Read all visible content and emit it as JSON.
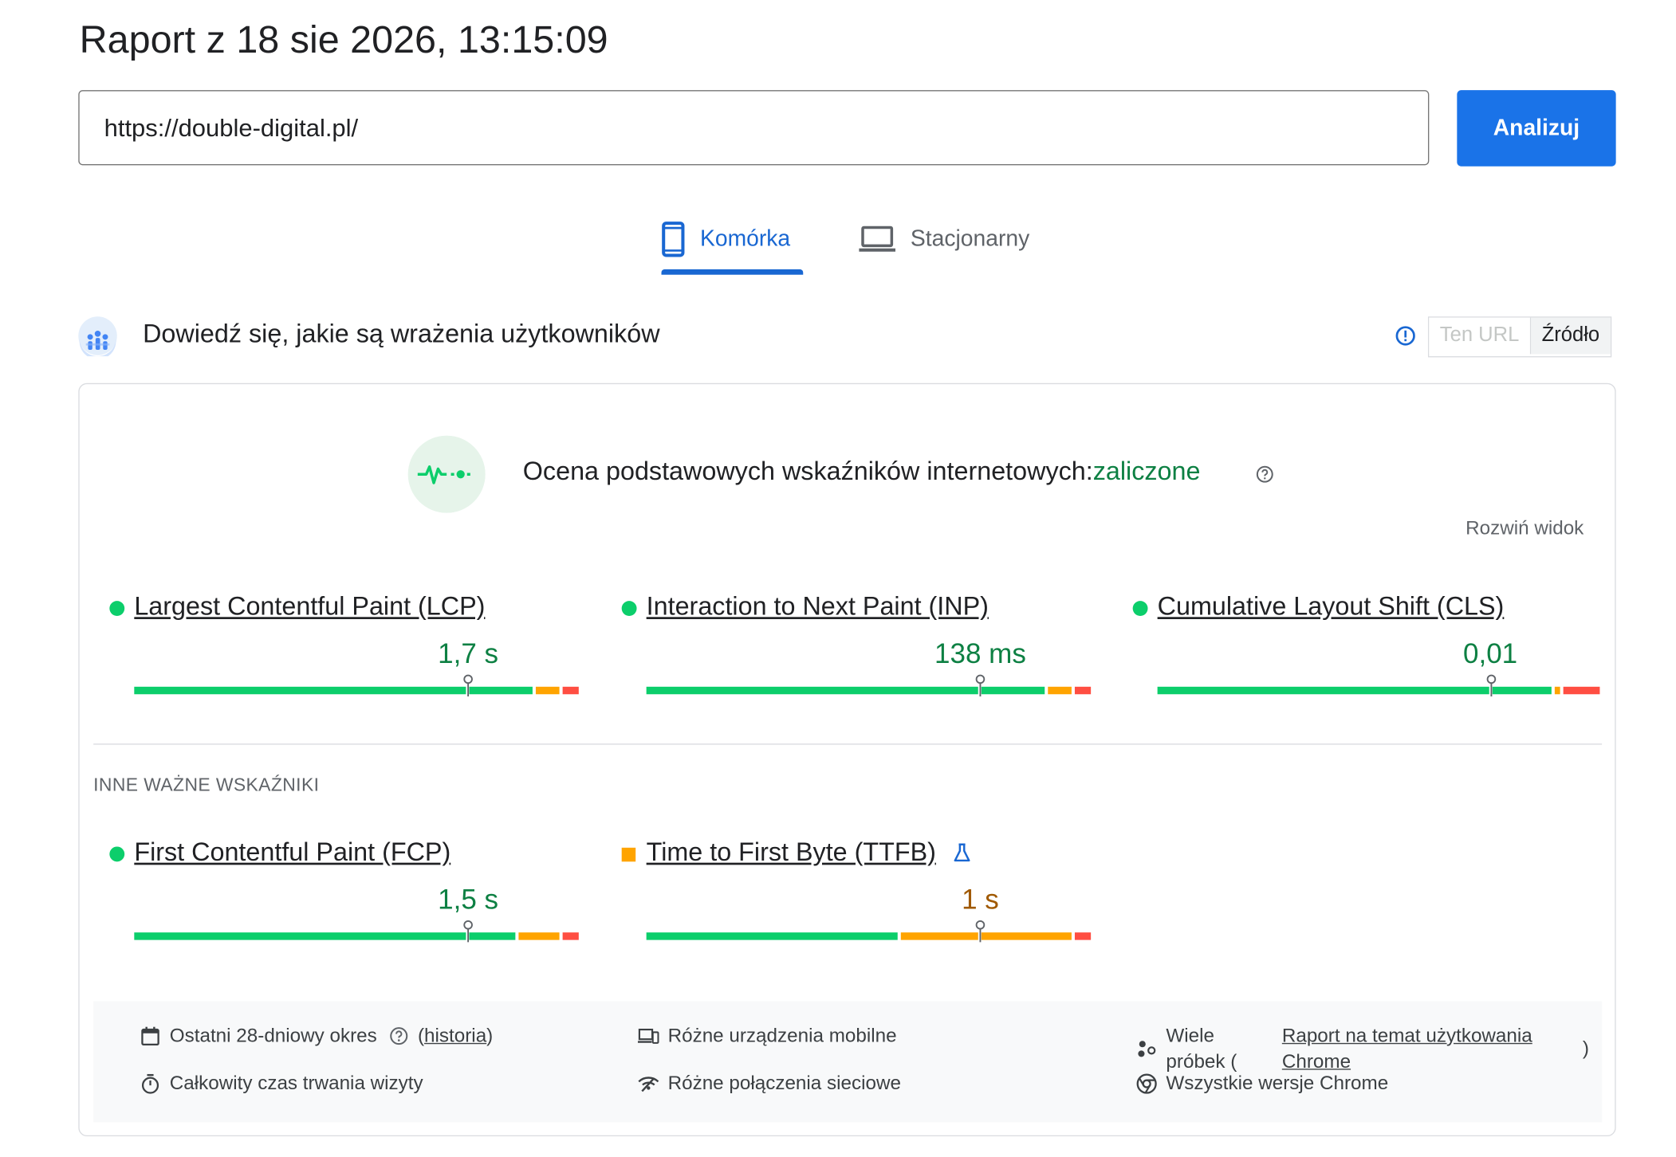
{
  "report": {
    "title": "Raport z 18 sie 2026, 13:15:09"
  },
  "url_bar": {
    "value": "https://double-digital.pl/",
    "analyze_label": "Analizuj"
  },
  "tabs": {
    "mobile": "Komórka",
    "desktop": "Stacjonarny",
    "active": "mobile"
  },
  "section": {
    "title": "Dowiedź się, jakie są wrażenia użytkowników",
    "toggle": {
      "url": "Ten URL",
      "origin": "Źródło",
      "selected": "origin"
    }
  },
  "assessment": {
    "label": "Ocena podstawowych wskaźników internetowych:",
    "result": "zaliczone",
    "expand": "Rozwiń widok"
  },
  "core_metrics": [
    {
      "name": "Largest Contentful Paint (LCP)",
      "value": "1,7 s",
      "status": "good",
      "distribution": {
        "good": 0.9,
        "needs_improvement": 0.06,
        "poor": 0.04
      },
      "p75_fraction": 0.75
    },
    {
      "name": "Interaction to Next Paint (INP)",
      "value": "138 ms",
      "status": "good",
      "distribution": {
        "good": 0.9,
        "needs_improvement": 0.06,
        "poor": 0.04
      },
      "p75_fraction": 0.75
    },
    {
      "name": "Cumulative Layout Shift (CLS)",
      "value": "0,01",
      "status": "good",
      "distribution": {
        "good": 0.89,
        "needs_improvement": 0.02,
        "poor": 0.09
      },
      "p75_fraction": 0.75
    }
  ],
  "other_label": "INNE WAŻNE WSKAŹNIKI",
  "other_metrics": [
    {
      "name": "First Contentful Paint (FCP)",
      "value": "1,5 s",
      "status": "good",
      "distribution": {
        "good": 0.86,
        "needs_improvement": 0.1,
        "poor": 0.04
      },
      "p75_fraction": 0.75
    },
    {
      "name": "Time to First Byte (TTFB)",
      "value": "1 s",
      "status": "average",
      "experimental": true,
      "distribution": {
        "good": 0.57,
        "needs_improvement": 0.39,
        "poor": 0.04
      },
      "p75_fraction": 0.75
    }
  ],
  "footer": {
    "period": "Ostatni 28-dniowy okres",
    "history_open": "(",
    "history_link": "historia",
    "history_close": ")",
    "devices": "Różne urządzenia mobilne",
    "samples": "Wiele próbek (",
    "samples_link": "Raport na temat użytkowania Chrome",
    "samples_close": ")",
    "duration": "Całkowity czas trwania wizyty",
    "network": "Różne połączenia sieciowe",
    "versions": "Wszystkie wersje Chrome"
  },
  "colors": {
    "accent": "#1a73e8",
    "good": "#0cce6b",
    "average": "#ffa400",
    "poor": "#ff4e42",
    "pass_text": "#0d8043"
  }
}
